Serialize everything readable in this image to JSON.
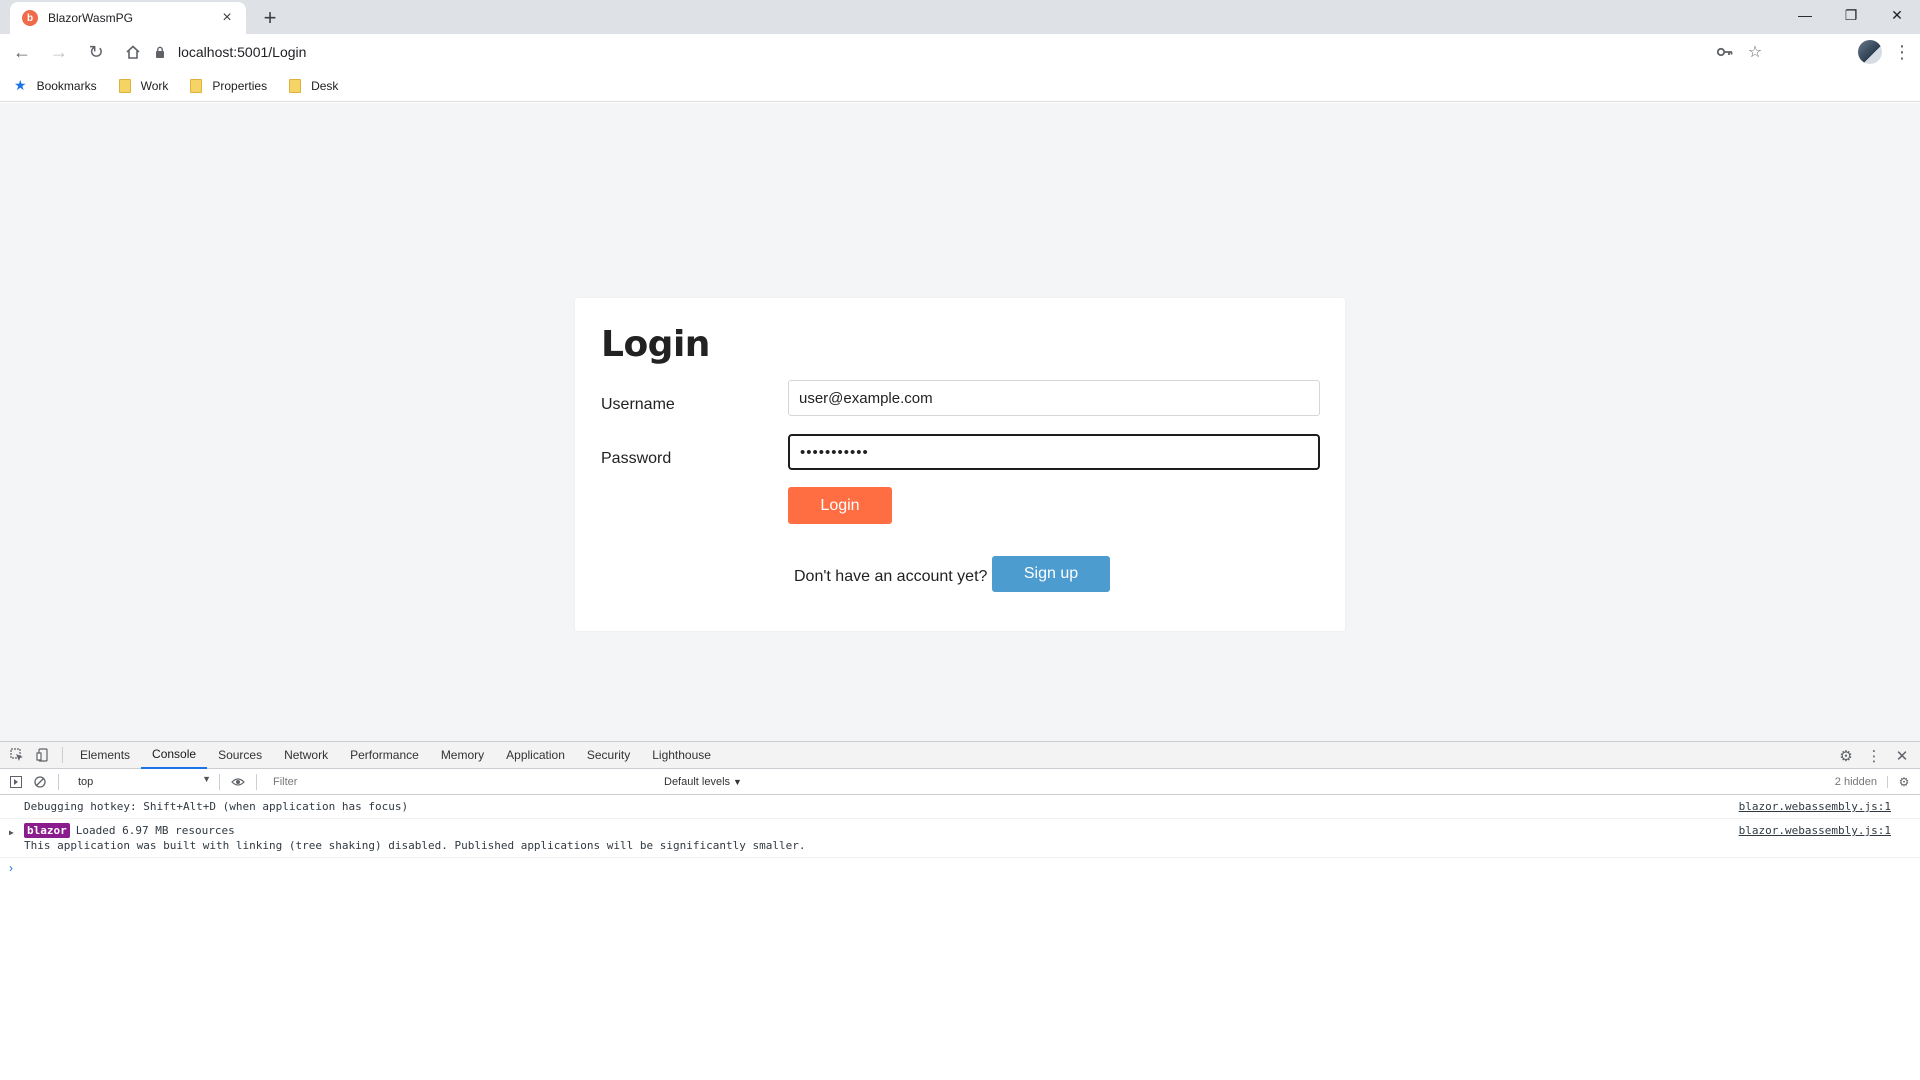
{
  "browser": {
    "tab": {
      "title": "BlazorWasmPG",
      "favicon": "blazor-favicon"
    },
    "address": "localhost:5001/Login",
    "bookmarks": [
      {
        "label": "Bookmarks",
        "icon": "star-icon"
      },
      {
        "label": "Work",
        "icon": "folder-icon"
      },
      {
        "label": "Properties",
        "icon": "folder-icon"
      },
      {
        "label": "Desk",
        "icon": "folder-icon"
      }
    ]
  },
  "login": {
    "title": "Login",
    "username_label": "Username",
    "username_value": "user@example.com",
    "password_label": "Password",
    "password_value": "•••••••••••",
    "login_button": "Login",
    "signup_prompt": "Don't have an account yet?",
    "signup_button": "Sign up"
  },
  "devtools": {
    "tabs": [
      "Elements",
      "Console",
      "Sources",
      "Network",
      "Performance",
      "Memory",
      "Application",
      "Security",
      "Lighthouse"
    ],
    "active_tab": "Console",
    "context": "top",
    "filter_placeholder": "Filter",
    "levels": "Default levels",
    "hidden": "2 hidden",
    "messages": [
      {
        "text": "Debugging hotkey: Shift+Alt+D (when application has focus)",
        "source": "blazor.webassembly.js:1"
      },
      {
        "badge": "blazor",
        "text": "Loaded 6.97 MB resources",
        "detail": "This application was built with linking (tree shaking) disabled. Published applications will be significantly smaller.",
        "source": "blazor.webassembly.js:1"
      }
    ]
  },
  "colors": {
    "login_button": "#ff6e43",
    "signup_button": "#4d9ccf",
    "page_background": "#f4f5f7",
    "blazor_badge": "#8a1c8d"
  }
}
